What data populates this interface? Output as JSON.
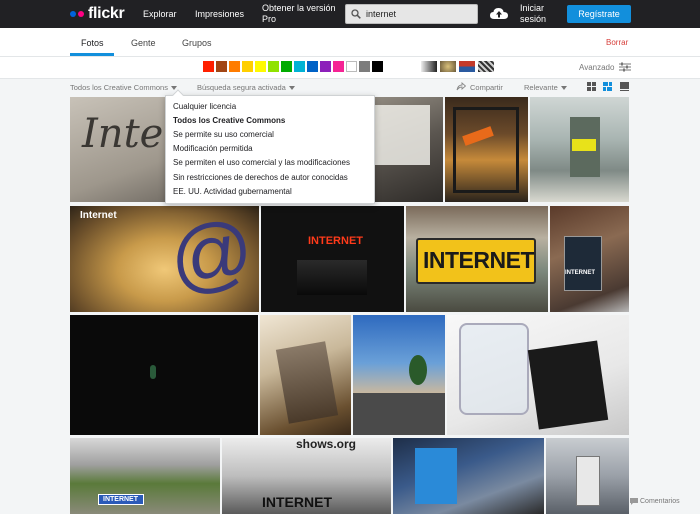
{
  "header": {
    "logo_text": "flickr",
    "logo_colors": [
      "#0063dc",
      "#ff0084"
    ],
    "nav": [
      "Explorar",
      "Impresiones"
    ],
    "pro_link": "Obtener la versión Pro",
    "search": {
      "value": "internet",
      "icon": "search-icon"
    },
    "upload_icon": "cloud-upload-icon",
    "signin": "Iniciar sesión",
    "register": "Regístrate",
    "accent": "#128fdc"
  },
  "subnav": {
    "tabs": [
      "Fotos",
      "Gente",
      "Grupos"
    ],
    "active": "Fotos",
    "clear": "Borrar"
  },
  "colors": {
    "swatches": [
      "#ff2000",
      "#a24615",
      "#ff7c00",
      "#ffcf00",
      "#fffa00",
      "#90e200",
      "#00ab00",
      "#00b2d4",
      "#0062c6",
      "#8c20ba",
      "#f52394",
      "#ffffff",
      "#7c7c7c",
      "#000000"
    ],
    "pattern_icons": [
      "black-and-white-icon",
      "shallow-dof-icon",
      "minimalist-icon",
      "pattern-icon"
    ],
    "advanced": "Avanzado"
  },
  "filters": {
    "license": "Todos los Creative Commons",
    "safe_search": "Búsqueda segura activada",
    "share": "Compartir",
    "sort": "Relevante"
  },
  "license_menu": [
    "Cualquier licencia",
    "Todos los Creative Commons",
    "Se permite su uso comercial",
    "Modificación permitida",
    "Se permiten el uso comercial y las modificaciones",
    "Sin restricciones de derechos de autor conocidas",
    "EE. UU. Actividad gubernamental"
  ],
  "license_selected": "Todos los Creative Commons",
  "photo_labels": {
    "p1": "Interi",
    "p6": "Internet",
    "p7": "@",
    "p8": "INTERNET",
    "p9": "INTERNET",
    "p10": "INTERNET",
    "p15": "INTERNET",
    "p16": "INTERNET",
    "p16_top": "shows.org"
  },
  "footer": {
    "comments": "Comentarios"
  }
}
